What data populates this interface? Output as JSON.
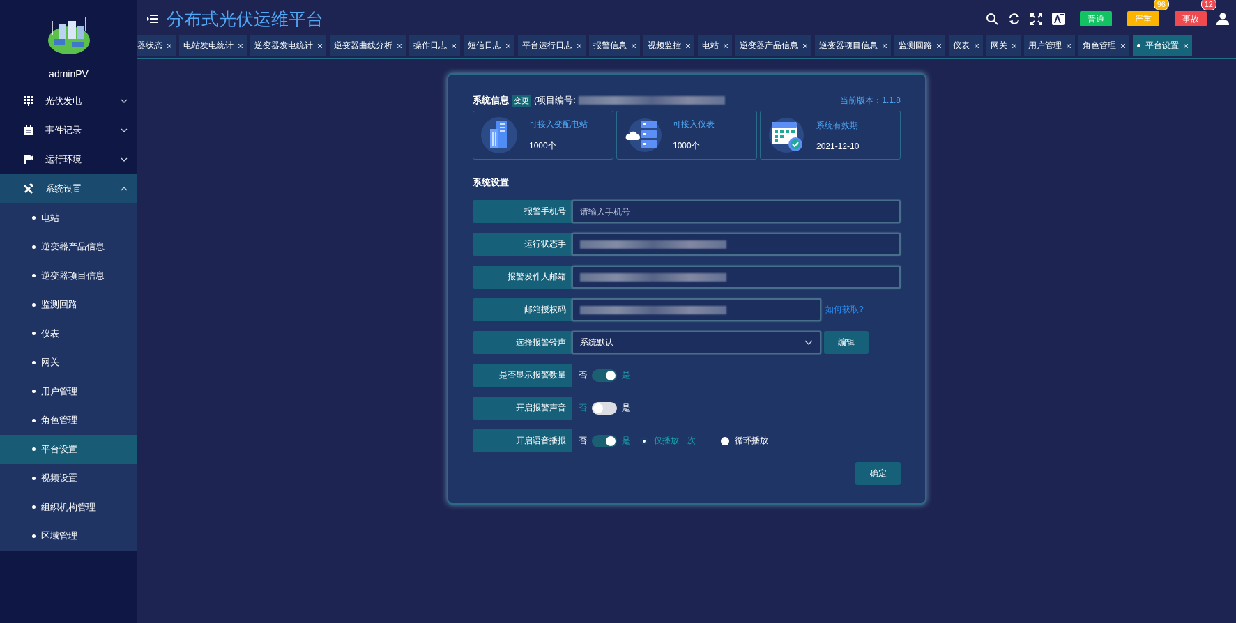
{
  "sidebar": {
    "username": "adminPV",
    "menu": [
      {
        "label": "光伏发电",
        "kind": "grid",
        "expanded": false,
        "selected": false
      },
      {
        "label": "事件记录",
        "kind": "log",
        "expanded": false,
        "selected": false
      },
      {
        "label": "运行环境",
        "kind": "camera",
        "expanded": false,
        "selected": false
      },
      {
        "label": "系统设置",
        "kind": "tools",
        "expanded": true,
        "selected": true,
        "children": [
          {
            "label": "电站",
            "selected": false
          },
          {
            "label": "逆变器产品信息",
            "selected": false
          },
          {
            "label": "逆变器项目信息",
            "selected": false
          },
          {
            "label": "监测回路",
            "selected": false
          },
          {
            "label": "仪表",
            "selected": false
          },
          {
            "label": "网关",
            "selected": false
          },
          {
            "label": "用户管理",
            "selected": false
          },
          {
            "label": "角色管理",
            "selected": false
          },
          {
            "label": "平台设置",
            "selected": true
          },
          {
            "label": "视频设置",
            "selected": false
          },
          {
            "label": "组织机构管理",
            "selected": false
          },
          {
            "label": "区域管理",
            "selected": false
          }
        ]
      }
    ]
  },
  "header": {
    "title": "分布式光伏运维平台",
    "alarms": [
      {
        "label": "普通",
        "color": "#13c262"
      },
      {
        "label": "严重",
        "count": "96",
        "color": "#fbb400"
      },
      {
        "label": "事故",
        "count": "12",
        "color": "#f04a51"
      }
    ]
  },
  "tabs": [
    {
      "label": "器状态",
      "selected": false
    },
    {
      "label": "电站发电统计",
      "selected": false
    },
    {
      "label": "逆变器发电统计",
      "selected": false
    },
    {
      "label": "逆变器曲线分析",
      "selected": false
    },
    {
      "label": "操作日志",
      "selected": false
    },
    {
      "label": "短信日志",
      "selected": false
    },
    {
      "label": "平台运行日志",
      "selected": false
    },
    {
      "label": "报警信息",
      "selected": false
    },
    {
      "label": "视频监控",
      "selected": false
    },
    {
      "label": "电站",
      "selected": false
    },
    {
      "label": "逆变器产品信息",
      "selected": false
    },
    {
      "label": "逆变器项目信息",
      "selected": false
    },
    {
      "label": "监测回路",
      "selected": false
    },
    {
      "label": "仪表",
      "selected": false
    },
    {
      "label": "网关",
      "selected": false
    },
    {
      "label": "用户管理",
      "selected": false
    },
    {
      "label": "角色管理",
      "selected": false
    },
    {
      "label": "平台设置",
      "selected": true
    }
  ],
  "system_info": {
    "title": "系统信息",
    "change_badge": "变更",
    "project_label": "(项目编号:",
    "version": "当前版本：1.1.8",
    "cards": [
      {
        "kind": "station",
        "title": "可接入变配电站",
        "value": "1000个"
      },
      {
        "kind": "meter",
        "title": "可接入仪表",
        "value": "1000个"
      },
      {
        "kind": "calendar",
        "title": "系统有效期",
        "value": "2021-12-10"
      }
    ]
  },
  "settings": {
    "title": "系统设置",
    "rows": [
      {
        "kind": "input",
        "label": "报警手机号",
        "placeholder": "请输入手机号"
      },
      {
        "kind": "input",
        "label": "运行状态手",
        "redacted": true
      },
      {
        "kind": "input",
        "label": "报警发件人邮箱",
        "redacted": true
      },
      {
        "kind": "input",
        "label": "邮箱授权码",
        "redacted": true,
        "link": "如何获取?"
      },
      {
        "kind": "select",
        "label": "选择报警铃声",
        "value": "系统默认",
        "button": "编辑"
      },
      {
        "kind": "switch",
        "label": "是否显示报警数量",
        "off_label": "否",
        "on_label": "是",
        "on": true
      },
      {
        "kind": "switch",
        "label": "开启报警声音",
        "off_label": "否",
        "on_label": "是",
        "on": false
      },
      {
        "kind": "switch",
        "label": "开启语音播报",
        "off_label": "否",
        "on_label": "是",
        "on": true,
        "options": [
          {
            "label": "仅播放一次",
            "selected": true
          },
          {
            "label": "循环播放",
            "selected": false
          }
        ]
      }
    ],
    "submit": "确定"
  }
}
